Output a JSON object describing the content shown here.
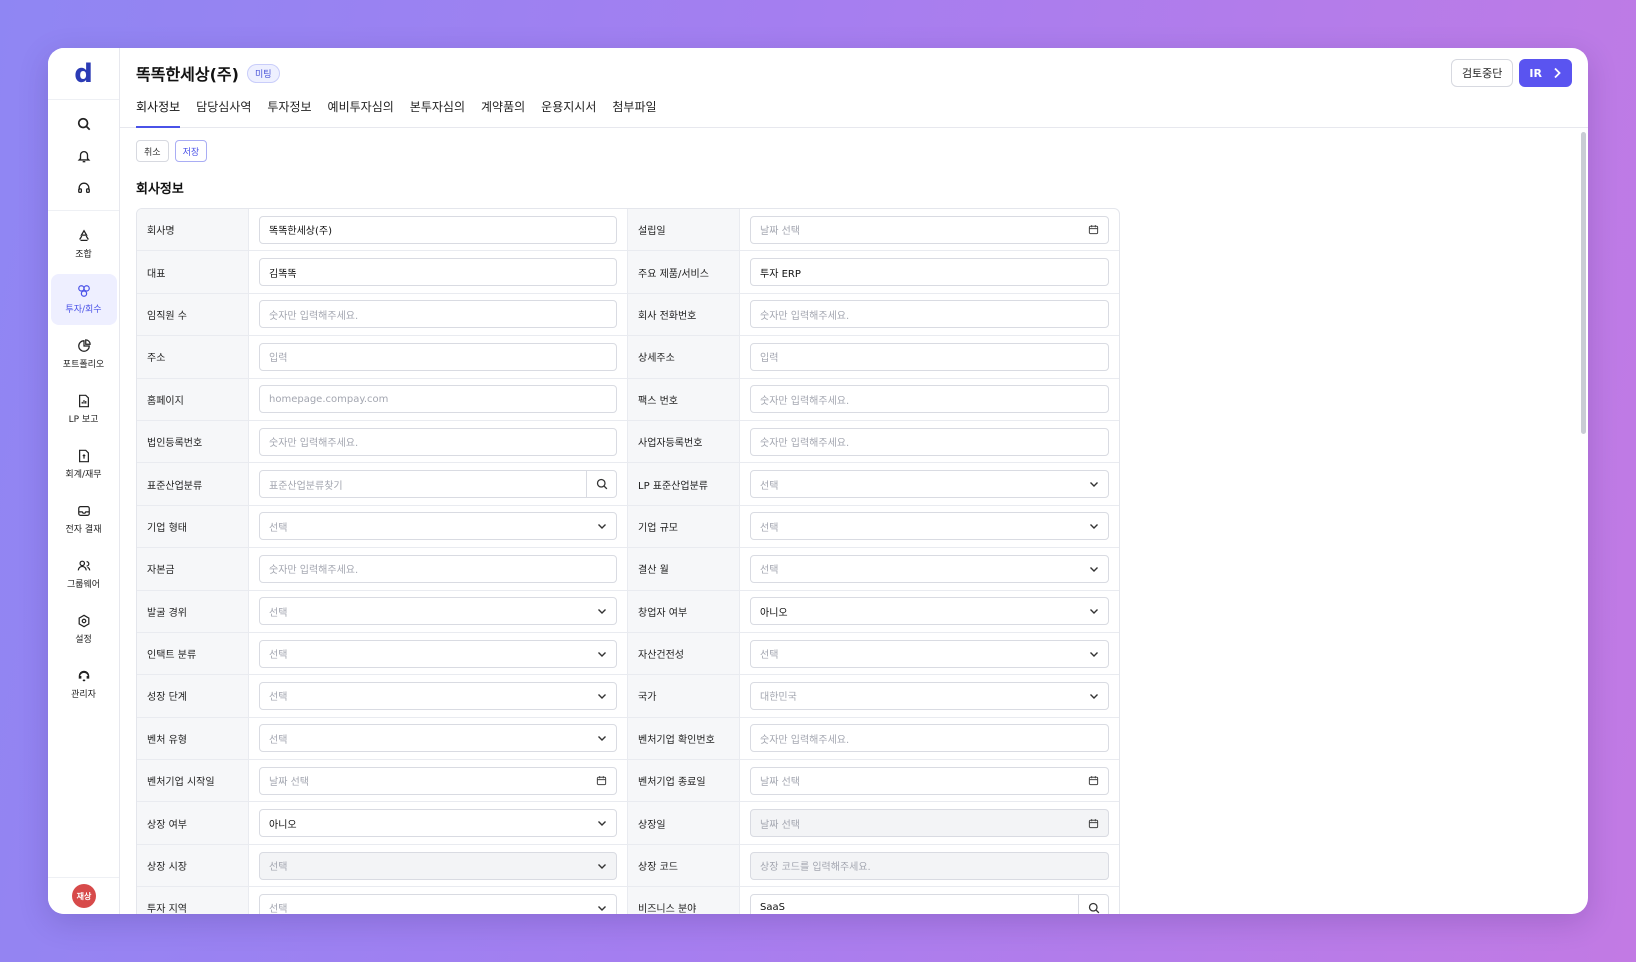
{
  "sidebar": {
    "logo": "d",
    "top_icons": [
      "search-icon",
      "bell-icon",
      "headset-icon"
    ],
    "items": [
      {
        "label": "조합",
        "icon": "recycle-icon"
      },
      {
        "label": "투자/회수",
        "icon": "investment-icon",
        "active": true
      },
      {
        "label": "포트폴리오",
        "icon": "pie-chart-icon"
      },
      {
        "label": "LP 보고",
        "icon": "report-icon"
      },
      {
        "label": "회계/재무",
        "icon": "finance-doc-icon"
      },
      {
        "label": "전자 결재",
        "icon": "inbox-icon"
      },
      {
        "label": "그룹웨어",
        "icon": "users-icon"
      },
      {
        "label": "설정",
        "icon": "gear-icon"
      },
      {
        "label": "관리자",
        "icon": "admin-icon"
      }
    ],
    "avatar": "재상"
  },
  "header": {
    "title": "똑똑한세상(주)",
    "badge": "미팅",
    "stop_review": "검토중단",
    "ir": "IR",
    "tabs": [
      {
        "label": "회사정보",
        "active": true
      },
      {
        "label": "담당심사역"
      },
      {
        "label": "투자정보"
      },
      {
        "label": "예비투자심의"
      },
      {
        "label": "본투자심의"
      },
      {
        "label": "계약품의"
      },
      {
        "label": "운용지시서"
      },
      {
        "label": "첨부파일"
      }
    ]
  },
  "actions": {
    "cancel": "취소",
    "save": "저장"
  },
  "section_title": "회사정보",
  "form_rows": [
    [
      {
        "label": "회사명",
        "value": "똑똑한세상(주)",
        "type": "text"
      },
      {
        "label": "설립일",
        "value": "날짜 선택",
        "type": "date",
        "placeholder": true
      }
    ],
    [
      {
        "label": "대표",
        "value": "김똑똑",
        "type": "text"
      },
      {
        "label": "주요 제품/서비스",
        "value": "투자 ERP",
        "type": "text"
      }
    ],
    [
      {
        "label": "임직원 수",
        "value": "숫자만 입력해주세요.",
        "type": "text",
        "placeholder": true
      },
      {
        "label": "회사 전화번호",
        "value": "숫자만 입력해주세요.",
        "type": "text",
        "placeholder": true
      }
    ],
    [
      {
        "label": "주소",
        "value": "입력",
        "type": "text",
        "placeholder": true
      },
      {
        "label": "상세주소",
        "value": "입력",
        "type": "text",
        "placeholder": true
      }
    ],
    [
      {
        "label": "홈페이지",
        "value": "homepage.compay.com",
        "type": "text",
        "placeholder": true
      },
      {
        "label": "팩스 번호",
        "value": "숫자만 입력해주세요.",
        "type": "text",
        "placeholder": true
      }
    ],
    [
      {
        "label": "법인등록번호",
        "value": "숫자만 입력해주세요.",
        "type": "text",
        "placeholder": true
      },
      {
        "label": "사업자등록번호",
        "value": "숫자만 입력해주세요.",
        "type": "text",
        "placeholder": true
      }
    ],
    [
      {
        "label": "표준산업분류",
        "value": "표준산업분류찾기",
        "type": "search",
        "placeholder": true
      },
      {
        "label": "LP 표준산업분류",
        "value": "선택",
        "type": "select",
        "placeholder": true
      }
    ],
    [
      {
        "label": "기업 형태",
        "value": "선택",
        "type": "select",
        "placeholder": true
      },
      {
        "label": "기업 규모",
        "value": "선택",
        "type": "select",
        "placeholder": true
      }
    ],
    [
      {
        "label": "자본금",
        "value": "숫자만 입력해주세요.",
        "type": "text",
        "placeholder": true
      },
      {
        "label": "결산 월",
        "value": "선택",
        "type": "select",
        "placeholder": true
      }
    ],
    [
      {
        "label": "발굴 경위",
        "value": "선택",
        "type": "select",
        "placeholder": true
      },
      {
        "label": "창업자 여부",
        "value": "아니오",
        "type": "select"
      }
    ],
    [
      {
        "label": "인택트 분류",
        "value": "선택",
        "type": "select",
        "placeholder": true
      },
      {
        "label": "자산건전성",
        "value": "선택",
        "type": "select",
        "placeholder": true
      }
    ],
    [
      {
        "label": "성장 단계",
        "value": "선택",
        "type": "select",
        "placeholder": true
      },
      {
        "label": "국가",
        "value": "대한민국",
        "type": "select",
        "placeholder": true
      }
    ],
    [
      {
        "label": "벤처 유형",
        "value": "선택",
        "type": "select",
        "placeholder": true
      },
      {
        "label": "벤처기업 확인번호",
        "value": "숫자만 입력해주세요.",
        "type": "text",
        "placeholder": true
      }
    ],
    [
      {
        "label": "벤처기업 시작일",
        "value": "날짜 선택",
        "type": "date",
        "placeholder": true
      },
      {
        "label": "벤처기업 종료일",
        "value": "날짜 선택",
        "type": "date",
        "placeholder": true
      }
    ],
    [
      {
        "label": "상장 여부",
        "value": "아니오",
        "type": "select"
      },
      {
        "label": "상장일",
        "value": "날짜 선택",
        "type": "date",
        "placeholder": true,
        "disabled": true
      }
    ],
    [
      {
        "label": "상장 시장",
        "value": "선택",
        "type": "select",
        "placeholder": true,
        "disabled": true
      },
      {
        "label": "상장 코드",
        "value": "상장 코드를 입력해주세요.",
        "type": "text",
        "placeholder": true,
        "disabled": true
      }
    ],
    [
      {
        "label": "투자 지역",
        "value": "선택",
        "type": "select",
        "placeholder": true
      },
      {
        "label": "비즈니스 분야",
        "value": "SaaS",
        "type": "search"
      }
    ]
  ]
}
